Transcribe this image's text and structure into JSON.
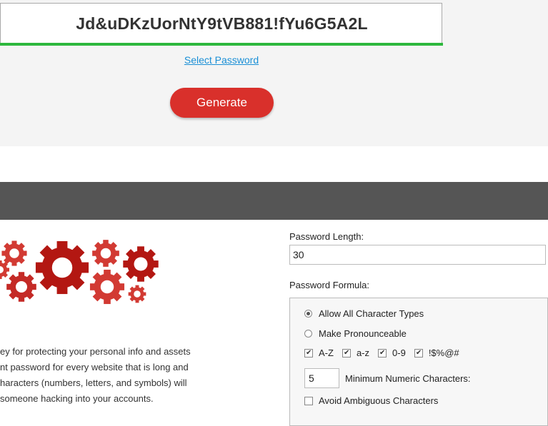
{
  "generator": {
    "password": "Jd&uDKzUorNtY9tVB881!fYu6G5A2L",
    "select_label": "Select Password",
    "generate_label": "Generate",
    "strength_color": "#2db83d",
    "button_color": "#d9302b"
  },
  "description": {
    "lines": [
      "ey for protecting your personal info and assets",
      "nt password for every website that is long and",
      "haracters (numbers, letters, and symbols) will",
      "someone hacking into your accounts."
    ]
  },
  "settings": {
    "length_label": "Password Length:",
    "length_value": "30",
    "formula_label": "Password Formula:",
    "options": {
      "allow_all": "Allow All Character Types",
      "pronounceable": "Make Pronounceable",
      "upper": "A-Z",
      "lower": "a-z",
      "digits": "0-9",
      "symbols": "!$%@#",
      "min_numeric_value": "5",
      "min_numeric_label": "Minimum Numeric Characters:",
      "avoid_ambiguous": "Avoid Ambiguous Characters"
    }
  },
  "icons": {
    "gears": "gears-illustration"
  }
}
